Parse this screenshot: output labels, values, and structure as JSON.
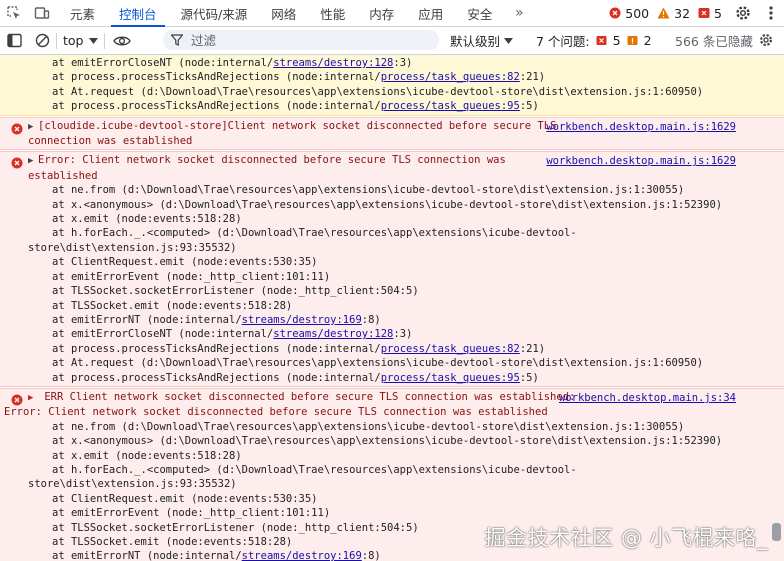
{
  "toolbar": {
    "tabs": [
      "元素",
      "控制台",
      "源代码/来源",
      "网络",
      "性能",
      "内存",
      "应用",
      "安全"
    ],
    "active_tab": "控制台",
    "more_tabs": "»",
    "errors_count": "500",
    "warnings_count": "32",
    "issues_count": "5"
  },
  "filterbar": {
    "context": "top",
    "filter_placeholder": "过滤",
    "levels_label": "默认级别",
    "issues_label": "7 个问题:",
    "issues_errors": "5",
    "issues_warnings": "2",
    "hidden_label": "566 条已隐藏"
  },
  "console": {
    "warn_lines": [
      {
        "pre": "at emitErrorCloseNT (node:internal/",
        "link": "streams/destroy:128",
        "post": ":3)"
      },
      {
        "pre": "at process.processTicksAndRejections (node:internal/",
        "link": "process/task_queues:82",
        "post": ":21)"
      },
      {
        "pre": "at At.request (d:\\Download\\Trae\\resources\\app\\extensions\\icube-devtool-store\\dist\\extension.js:1:60950)",
        "link": "",
        "post": ""
      },
      {
        "pre": "at process.processTicksAndRejections (node:internal/",
        "link": "process/task_queues:95",
        "post": ":5)"
      }
    ],
    "msg1": {
      "line1": "[cloudide.icube-devtool-store]Client network socket disconnected before secure TLS",
      "line2": "connection was established",
      "source": "workbench.desktop.main.js:1629"
    },
    "msg2": {
      "line1": "Error: Client network socket disconnected before secure TLS connection was",
      "line2": "established",
      "source": "workbench.desktop.main.js:1629",
      "stack": [
        {
          "pre": "at ne.from (d:\\Download\\Trae\\resources\\app\\extensions\\icube-devtool-store\\dist\\extension.js:1:30055)",
          "link": "",
          "post": "",
          "indent": true
        },
        {
          "pre": "at x.<anonymous> (d:\\Download\\Trae\\resources\\app\\extensions\\icube-devtool-store\\dist\\extension.js:1:52390)",
          "link": "",
          "post": "",
          "indent": true
        },
        {
          "pre": "at x.emit (node:events:518:28)",
          "link": "",
          "post": "",
          "indent": true
        },
        {
          "pre": "at h.forEach._.<computed> (d:\\Download\\Trae\\resources\\app\\extensions\\icube-devtool-",
          "link": "",
          "post": "",
          "indent": true
        },
        {
          "pre": "store\\dist\\extension.js:93:35532)",
          "link": "",
          "post": "",
          "indent": false
        },
        {
          "pre": "at ClientRequest.emit (node:events:530:35)",
          "link": "",
          "post": "",
          "indent": true
        },
        {
          "pre": "at emitErrorEvent (node:_http_client:101:11)",
          "link": "",
          "post": "",
          "indent": true
        },
        {
          "pre": "at TLSSocket.socketErrorListener (node:_http_client:504:5)",
          "link": "",
          "post": "",
          "indent": true
        },
        {
          "pre": "at TLSSocket.emit (node:events:518:28)",
          "link": "",
          "post": "",
          "indent": true
        },
        {
          "pre": "at emitErrorNT (node:internal/",
          "link": "streams/destroy:169",
          "post": ":8)",
          "indent": true
        },
        {
          "pre": "at emitErrorCloseNT (node:internal/",
          "link": "streams/destroy:128",
          "post": ":3)",
          "indent": true
        },
        {
          "pre": "at process.processTicksAndRejections (node:internal/",
          "link": "process/task_queues:82",
          "post": ":21)",
          "indent": true
        },
        {
          "pre": "at At.request (d:\\Download\\Trae\\resources\\app\\extensions\\icube-devtool-store\\dist\\extension.js:1:60950)",
          "link": "",
          "post": "",
          "indent": true
        },
        {
          "pre": "at process.processTicksAndRejections (node:internal/",
          "link": "process/task_queues:95",
          "post": ":5)",
          "indent": true
        }
      ]
    },
    "msg3": {
      "line1": "ERR Client network socket disconnected before secure TLS connection was established:",
      "line2": "Error: Client network socket disconnected before secure TLS connection was established",
      "source": "workbench.desktop.main.js:34",
      "stack": [
        {
          "pre": "at ne.from (d:\\Download\\Trae\\resources\\app\\extensions\\icube-devtool-store\\dist\\extension.js:1:30055)",
          "link": "",
          "post": "",
          "indent": true
        },
        {
          "pre": "at x.<anonymous> (d:\\Download\\Trae\\resources\\app\\extensions\\icube-devtool-store\\dist\\extension.js:1:52390)",
          "link": "",
          "post": "",
          "indent": true
        },
        {
          "pre": "at x.emit (node:events:518:28)",
          "link": "",
          "post": "",
          "indent": true
        },
        {
          "pre": "at h.forEach._.<computed> (d:\\Download\\Trae\\resources\\app\\extensions\\icube-devtool-",
          "link": "",
          "post": "",
          "indent": true
        },
        {
          "pre": "store\\dist\\extension.js:93:35532)",
          "link": "",
          "post": "",
          "indent": false
        },
        {
          "pre": "at ClientRequest.emit (node:events:530:35)",
          "link": "",
          "post": "",
          "indent": true
        },
        {
          "pre": "at emitErrorEvent (node:_http_client:101:11)",
          "link": "",
          "post": "",
          "indent": true
        },
        {
          "pre": "at TLSSocket.socketErrorListener (node:_http_client:504:5)",
          "link": "",
          "post": "",
          "indent": true
        },
        {
          "pre": "at TLSSocket.emit (node:events:518:28)",
          "link": "",
          "post": "",
          "indent": true
        },
        {
          "pre": "at emitErrorNT (node:internal/",
          "link": "streams/destroy:169",
          "post": ":8)",
          "indent": true
        }
      ]
    }
  },
  "watermark": "掘金技术社区 @ 小飞棍来咯_"
}
